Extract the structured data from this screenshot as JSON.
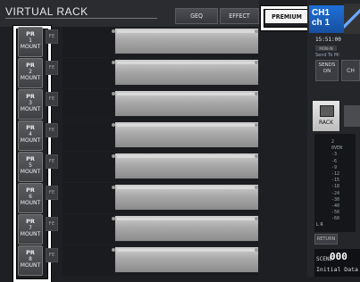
{
  "header": {
    "title": "VIRTUAL RACK",
    "tabs": [
      {
        "label": "GEQ"
      },
      {
        "label": "EFFECT"
      },
      {
        "label": "PREMIUM"
      }
    ]
  },
  "rack": {
    "mount_label": "MOUNT",
    "fe_label": "FE",
    "slots": [
      {
        "pr": "PR",
        "num": "1"
      },
      {
        "pr": "PR",
        "num": "2"
      },
      {
        "pr": "PR",
        "num": "3"
      },
      {
        "pr": "PR",
        "num": "4"
      },
      {
        "pr": "PR",
        "num": "5"
      },
      {
        "pr": "PR",
        "num": "6"
      },
      {
        "pr": "PR",
        "num": "7"
      },
      {
        "pr": "PR",
        "num": "8"
      }
    ]
  },
  "channel": {
    "name_line1": "CH1",
    "name_line2": "ch 1",
    "time": "15:51:00",
    "mini_label": "MON-IN",
    "send_label": "Send To Mi",
    "sends_label": "SENDS",
    "sends_sub": "ON",
    "ch_btn_label": "CH",
    "rack_label": "RACK",
    "db_scale": [
      "2",
      "0VEN",
      "-3",
      "-6",
      "-9",
      "-12",
      "-15",
      "-18",
      "-24",
      "-30",
      "-40",
      "-50",
      "-60"
    ],
    "meter_lr": "L R",
    "return_label": "RETURN",
    "scene_label": "SCENE",
    "scene_number": "000",
    "scene_name": "Initial Data"
  },
  "colors": {
    "accent_blue": "#1f6fd8",
    "highlight": "#ffffff",
    "background": "#1e1f23"
  }
}
